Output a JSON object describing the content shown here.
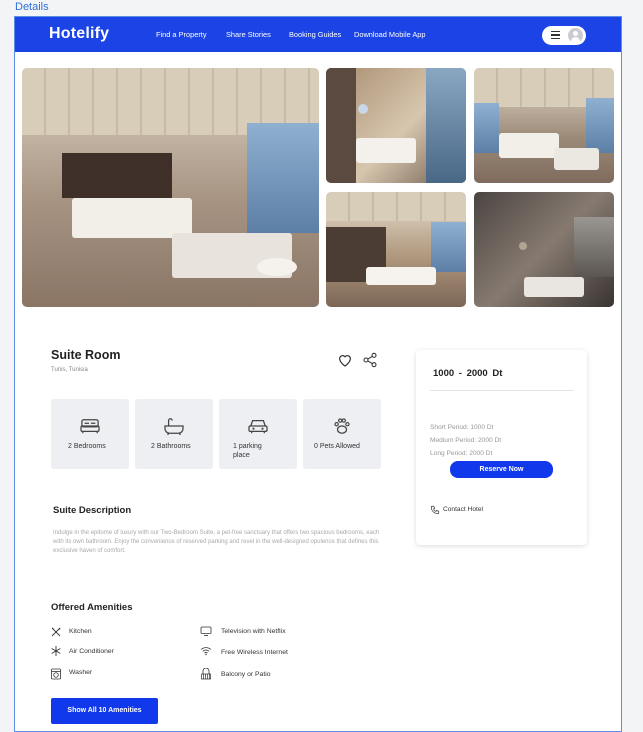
{
  "frame": {
    "label": "Details"
  },
  "nav": {
    "logo": "Hotelify",
    "links": [
      "Find a Property",
      "Share Stories",
      "Booking Guides",
      "Download Mobile App"
    ],
    "menu_icon": "hamburger-icon",
    "avatar_icon": "user-avatar-icon"
  },
  "gallery": [
    "suite-bedroom",
    "bathroom",
    "bedroom-view",
    "dining-room",
    "shower-room"
  ],
  "property": {
    "name": "Suite Room",
    "location": "Tunis, Tunisia"
  },
  "features": [
    {
      "icon": "bed-icon",
      "label": "2 Bedrooms"
    },
    {
      "icon": "bathtub-icon",
      "label": "2 Bathrooms"
    },
    {
      "icon": "car-icon",
      "label": "1 parking place"
    },
    {
      "icon": "paw-icon",
      "label": "0 Pets Allowed"
    }
  ],
  "description": {
    "title": "Suite Description",
    "text": "Indulge in the epitome of luxury with our Two-Bedroom Suite, a pet-free sanctuary that offers two spacious bedrooms, each with its own bathroom. Enjoy the convenience of reserved parking and revel in the well-designed opulence that defines this exclusive haven of comfort."
  },
  "amenities": {
    "title": "Offered Amenities",
    "items": [
      {
        "icon": "kitchen-icon",
        "label": "Kitchen"
      },
      {
        "icon": "television-icon",
        "label": "Television with Netflix"
      },
      {
        "icon": "snowflake-icon",
        "label": "Air Conditioner"
      },
      {
        "icon": "wifi-icon",
        "label": "Free Wireless Internet"
      },
      {
        "icon": "washer-icon",
        "label": "Washer"
      },
      {
        "icon": "balcony-icon",
        "label": "Balcony or Patio"
      }
    ],
    "button": "Show All 10 Amenities"
  },
  "booking": {
    "price_range": "1000 -  2000 Dt",
    "periods": [
      "Short Period:  1000 Dt",
      "Medium Period:  2000 Dt",
      "Long Period:  2000 Dt"
    ],
    "reserve_button": "Reserve Now",
    "contact": "Contact Hotel"
  },
  "colors": {
    "brand": "#1b43e5",
    "button": "#1238ec",
    "tile": "#eeeff2"
  }
}
